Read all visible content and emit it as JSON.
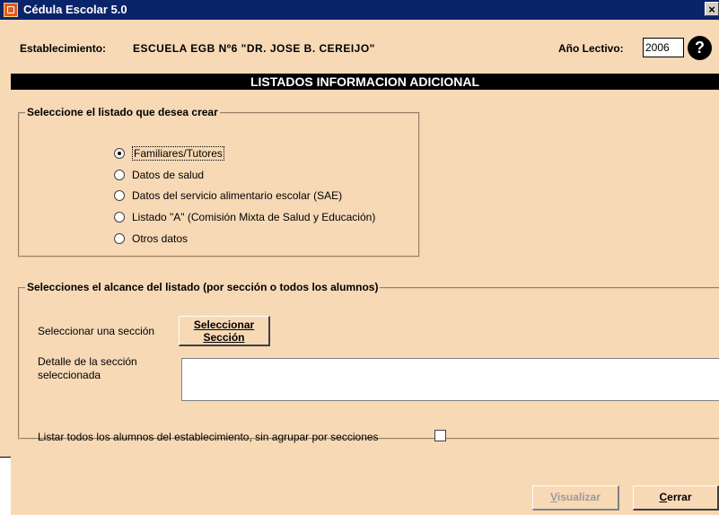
{
  "window": {
    "title": "Cédula Escolar 5.0",
    "close": "×"
  },
  "header": {
    "establishment_label": "Establecimiento:",
    "establishment_value": "ESCUELA EGB Nº6 \"DR. JOSE B. CEREIJO\"",
    "year_label": "Año Lectivo:",
    "year_value": "2006",
    "help": "?"
  },
  "banner": "LISTADOS INFORMACION ADICIONAL",
  "listing_group": {
    "legend": "Seleccione el listado que desea crear",
    "options": [
      {
        "label": "Familiares/Tutores",
        "checked": true
      },
      {
        "label": "Datos de salud",
        "checked": false
      },
      {
        "label": "Datos del servicio alimentario escolar (SAE)",
        "checked": false
      },
      {
        "label": "Listado \"A\" (Comisión Mixta de Salud y Educación)",
        "checked": false
      },
      {
        "label": "Otros datos",
        "checked": false
      }
    ]
  },
  "scope_group": {
    "legend": "Selecciones el alcance del listado (por sección o todos los alumnos)",
    "select_section_label": "Seleccionar una sección",
    "select_button_line1": "Seleccionar",
    "select_button_line2": "Sección",
    "detail_label": "Detalle de la sección seleccionada",
    "detail_value": "",
    "list_all_label": "Listar todos los alumnos del establecimiento, sin agrupar por secciones",
    "list_all_checked": false
  },
  "actions": {
    "visualize_hotkey": "V",
    "visualize_rest": "isualizar",
    "close_hotkey": "C",
    "close_rest": "errar"
  },
  "colors": {
    "background": "#f7d9b6",
    "titlebar": "#0a246a",
    "banner": "#000000"
  }
}
